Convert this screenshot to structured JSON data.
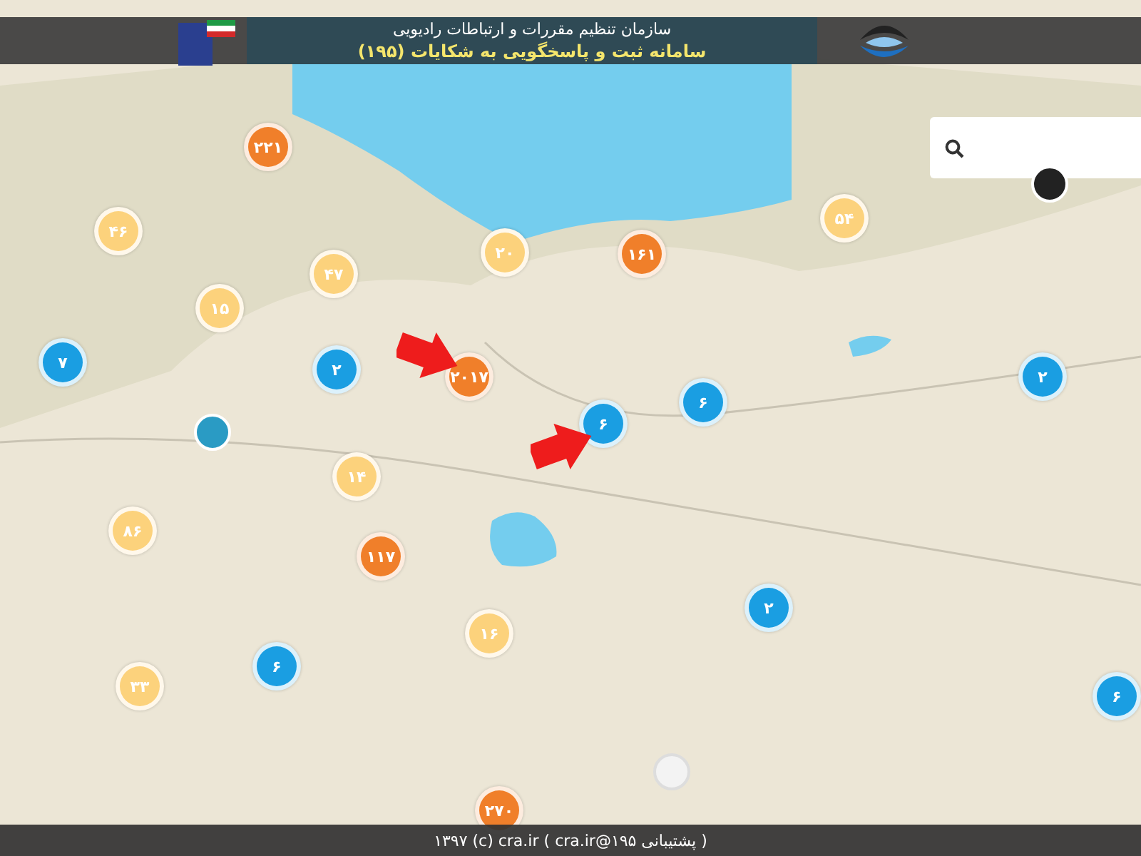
{
  "header": {
    "title": "سازمان تنظیم مقررات و ارتباطات رادیویی",
    "subtitle": "سامانه ثبت و پاسخگویی به شکایات (۱۹۵)"
  },
  "markers": [
    {
      "label": "۲۲۱",
      "color": "#f07f2a"
    },
    {
      "label": "۴۶",
      "color": "#fcd27c"
    },
    {
      "label": "۴۷",
      "color": "#fcd27c"
    },
    {
      "label": "۱۵",
      "color": "#fcd27c"
    },
    {
      "label": "۲۰",
      "color": "#fcd27c"
    },
    {
      "label": "۱۶۱",
      "color": "#f07f2a"
    },
    {
      "label": "۵۴",
      "color": "#fcd27c"
    },
    {
      "label": "۷",
      "color": "#1a9ee2"
    },
    {
      "label": "۲",
      "color": "#1a9ee2"
    },
    {
      "label": "۲۰۱۷",
      "color": "#f07f2a"
    },
    {
      "label": "۶",
      "color": "#1a9ee2"
    },
    {
      "label": "۶",
      "color": "#1a9ee2"
    },
    {
      "label": "۲",
      "color": "#1a9ee2"
    },
    {
      "label": "۱۴",
      "color": "#fcd27c"
    },
    {
      "label": "۸۶",
      "color": "#fcd27c"
    },
    {
      "label": "۱۱۷",
      "color": "#f07f2a"
    },
    {
      "label": "۱۶",
      "color": "#fcd27c"
    },
    {
      "label": "۲",
      "color": "#1a9ee2"
    },
    {
      "label": "۶",
      "color": "#1a9ee2"
    },
    {
      "label": "۳۳",
      "color": "#fcd27c"
    },
    {
      "label": "۶",
      "color": "#1a9ee2"
    },
    {
      "label": "۲۷۰",
      "color": "#f07f2a"
    }
  ],
  "footer": "( پشتیبانی ۱۹۵@cra.ir ) ۱۳۹۷ (c) cra.ir"
}
